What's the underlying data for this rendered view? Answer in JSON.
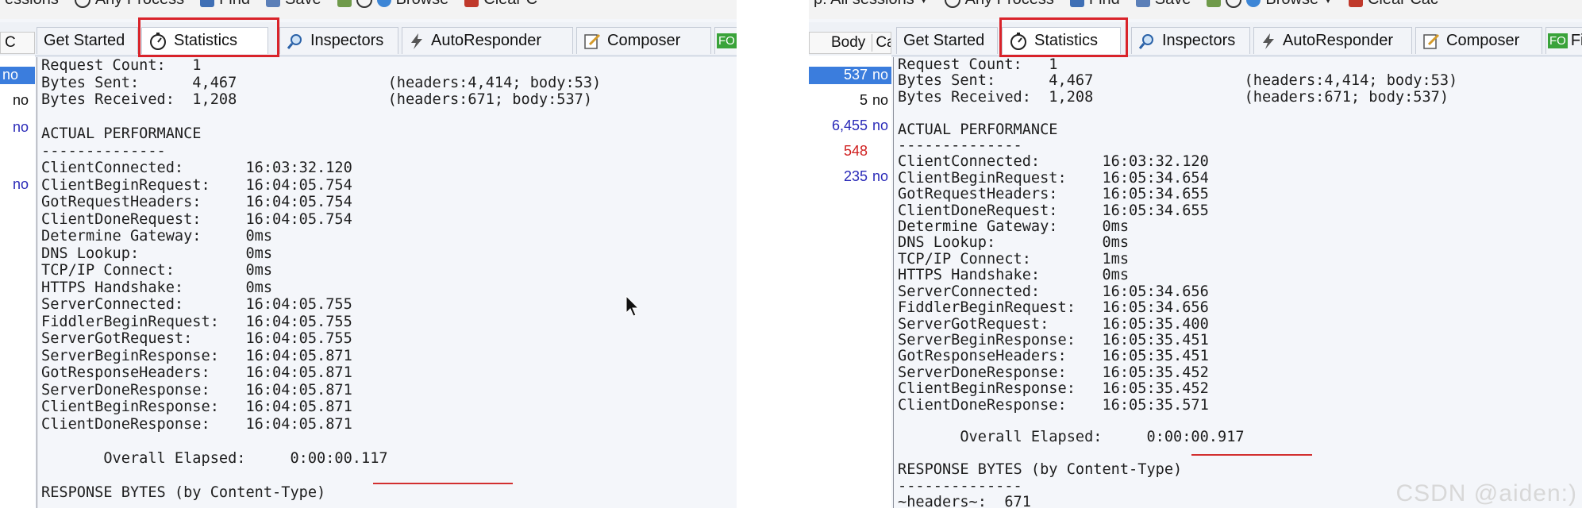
{
  "left": {
    "toolbar": [
      "essions",
      "Any Process",
      "Find",
      "Save",
      "Browse",
      "Clear C"
    ],
    "grid_header": "C",
    "side_rows": [
      {
        "text": "no",
        "selected": true
      },
      {
        "text": "no",
        "selected": false
      },
      {
        "text": "no",
        "selected": false
      },
      {
        "text": "no",
        "selected": false
      }
    ],
    "tabs": [
      "Get Started",
      "Statistics",
      "Inspectors",
      "AutoResponder",
      "Composer",
      "FO"
    ],
    "stats_lines": [
      "Request Count:   1",
      "Bytes Sent:      4,467                 (headers:4,414; body:53)",
      "Bytes Received:  1,208                 (headers:671; body:537)",
      "",
      "ACTUAL PERFORMANCE",
      "--------------",
      "ClientConnected:       16:03:32.120",
      "ClientBeginRequest:    16:04:05.754",
      "GotRequestHeaders:     16:04:05.754",
      "ClientDoneRequest:     16:04:05.754",
      "Determine Gateway:     0ms",
      "DNS Lookup:            0ms",
      "TCP/IP Connect:        0ms",
      "HTTPS Handshake:       0ms",
      "ServerConnected:       16:04:05.755",
      "FiddlerBeginRequest:   16:04:05.755",
      "ServerGotRequest:      16:04:05.755",
      "ServerBeginResponse:   16:04:05.871",
      "GotResponseHeaders:    16:04:05.871",
      "ServerDoneResponse:    16:04:05.871",
      "ClientBeginResponse:   16:04:05.871",
      "ClientDoneResponse:    16:04:05.871",
      "",
      "       Overall Elapsed:     0:00:00.117",
      "",
      "RESPONSE BYTES (by Content-Type)"
    ]
  },
  "right": {
    "toolbar": [
      "p: All sessions",
      "Any Process",
      "Find",
      "Save",
      "Browse",
      "Clear Cac"
    ],
    "grid_header": [
      "Body",
      "Ca"
    ],
    "side_rows": [
      {
        "value": "537",
        "suffix": "no",
        "color": "#ffffff",
        "selected": true
      },
      {
        "value": "5",
        "suffix": "no",
        "color": "#111111",
        "selected": false
      },
      {
        "value": "6,455",
        "suffix": "no",
        "color": "#2a2ab8",
        "selected": false
      },
      {
        "value": "548",
        "suffix": "",
        "color": "#d02020",
        "selected": false
      },
      {
        "value": "235",
        "suffix": "no",
        "color": "#2a2ab8",
        "selected": false
      }
    ],
    "tabs": [
      "Get Started",
      "Statistics",
      "Inspectors",
      "AutoResponder",
      "Composer",
      "Fi"
    ],
    "stats_lines": [
      "Request Count:   1",
      "Bytes Sent:      4,467                 (headers:4,414; body:53)",
      "Bytes Received:  1,208                 (headers:671; body:537)",
      "",
      "ACTUAL PERFORMANCE",
      "--------------",
      "ClientConnected:       16:03:32.120",
      "ClientBeginRequest:    16:05:34.654",
      "GotRequestHeaders:     16:05:34.655",
      "ClientDoneRequest:     16:05:34.655",
      "Determine Gateway:     0ms",
      "DNS Lookup:            0ms",
      "TCP/IP Connect:        1ms",
      "HTTPS Handshake:       0ms",
      "ServerConnected:       16:05:34.656",
      "FiddlerBeginRequest:   16:05:34.656",
      "ServerGotRequest:      16:05:35.400",
      "ServerBeginResponse:   16:05:35.451",
      "GotResponseHeaders:    16:05:35.451",
      "ServerDoneResponse:    16:05:35.452",
      "ClientBeginResponse:   16:05:35.452",
      "ClientDoneResponse:    16:05:35.571",
      "",
      "       Overall Elapsed:     0:00:00.917",
      "",
      "RESPONSE BYTES (by Content-Type)",
      "--------------",
      "~headers~:  671"
    ]
  },
  "watermark": "CSDN @aiden:)",
  "colors": {
    "highlight": "#d9232a",
    "selection": "#3b7ddd",
    "link_blue": "#2a2ab8",
    "error_red": "#d02020"
  }
}
